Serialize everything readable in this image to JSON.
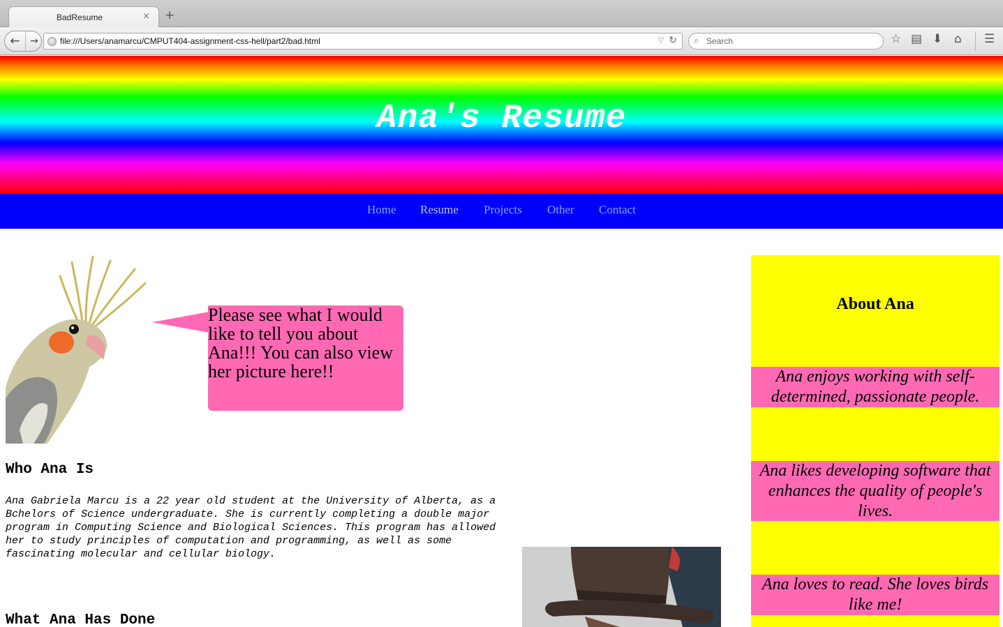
{
  "browser": {
    "tab_title": "BadResume",
    "tab_close": "×",
    "new_tab": "+",
    "url": "file:///Users/anamarcu/CMPUT404-assignment-css-hell/part2/bad.html",
    "search_placeholder": "Search",
    "icons": [
      "back-arrow-icon",
      "forward-arrow-icon",
      "globe-icon",
      "reload-icon",
      "search-icon",
      "bookmark-star-icon",
      "reading-list-icon",
      "download-icon",
      "home-icon",
      "menu-icon"
    ]
  },
  "header": {
    "title": "Ana's Resume"
  },
  "nav": {
    "items": [
      {
        "label": "Home"
      },
      {
        "label": "Resume"
      },
      {
        "label": "Projects"
      },
      {
        "label": "Other"
      },
      {
        "label": "Contact"
      }
    ]
  },
  "bubble": {
    "text": "Please see what I would like to tell you about Ana!!! You can also view her picture here!!"
  },
  "main": {
    "who_heading": "Who Ana Is",
    "bio": "Ana Gabriela Marcu is a 22 year old student at the University of Alberta, as a Bchelors of Science undergraduate. She is currently completing a double major program in Computing Science and Biological Sciences. This program has allowed her to study principles of computation and programming, as well as some fascinating molecular and cellular biology.",
    "done_heading": "What Ana Has Done"
  },
  "sidebar": {
    "title": "About Ana",
    "facts": [
      "Ana enjoys working with self-determined, passionate people.",
      "Ana likes developing software that enhances the quality of people's lives.",
      "Ana loves to read. She loves birds like me!"
    ]
  },
  "colors": {
    "nav_bg": "#0000ff",
    "sidebar_bg": "#ffff00",
    "pink": "#ff69b4"
  }
}
